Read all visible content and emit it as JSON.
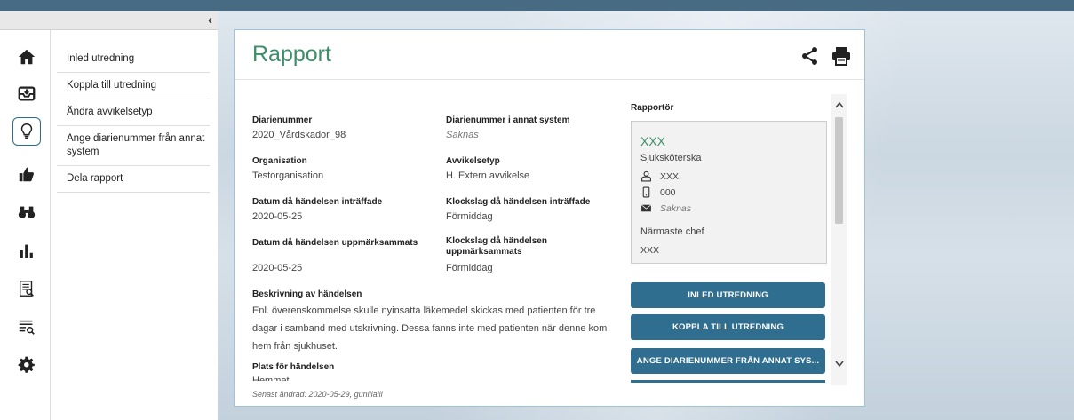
{
  "sidebar": {
    "collapse_glyph": "‹",
    "icons": [
      "home-icon",
      "inbox-icon",
      "lightbulb-icon",
      "thumbs-up-icon",
      "binoculars-icon",
      "bar-chart-icon",
      "document-search-icon",
      "list-search-icon",
      "settings-icon"
    ],
    "active_icon": "lightbulb-icon"
  },
  "menu": {
    "items": [
      {
        "label": "Inled utredning"
      },
      {
        "label": "Koppla till utredning"
      },
      {
        "label": "Ändra avvikelsetyp"
      },
      {
        "label": "Ange diarienummer från annat system"
      },
      {
        "label": "Dela rapport"
      }
    ]
  },
  "report": {
    "title": "Rapport",
    "fields": {
      "diarienummer_label": "Diarienummer",
      "diarienummer_value": "2020_Vårdskador_98",
      "diarienummer_annat_label": "Diarienummer i annat system",
      "diarienummer_annat_value": "Saknas",
      "organisation_label": "Organisation",
      "organisation_value": "Testorganisation",
      "avvikelsetyp_label": "Avvikelsetyp",
      "avvikelsetyp_value": "H. Extern avvikelse",
      "datum_inffade_label": "Datum då händelsen inträffade",
      "datum_inffade_value": "2020-05-25",
      "klockslag_inffade_label": "Klockslag då händelsen inträffade",
      "klockslag_inffade_value": "Förmiddag",
      "datum_uppm_label": "Datum då händelsen uppmärksammats",
      "datum_uppm_value": "2020-05-25",
      "klockslag_uppm_label": "Klockslag då händelsen uppmärksammats",
      "klockslag_uppm_value": "Förmiddag"
    },
    "beskrivning_label": "Beskrivning av händelsen",
    "beskrivning_text": "Enl. överenskommelse skulle nyinsatta läkemedel skickas med patienten för tre dagar i samband med utskrivning.  Dessa fanns inte med patienten när denne kom hem från sjukhuset.",
    "plats_label": "Plats för händelsen",
    "plats_value": "Hemmet",
    "footer": "Senast ändrad: 2020-05-29, gunillalil"
  },
  "rapportor": {
    "label": "Rapportör",
    "name": "XXX",
    "role": "Sjuksköterska",
    "user": "XXX",
    "phone": "000",
    "email": "Saknas",
    "chef_label": "Närmaste chef",
    "chef": "XXX"
  },
  "actions": {
    "inled": "INLED UTREDNING",
    "koppla": "KOPPLA TILL UTREDNING",
    "ange": "ANGE DIARIENUMMER FRÅN ANNAT SYS..."
  },
  "colors": {
    "accent_green": "#3e8e6a",
    "button_blue": "#2f6e8f",
    "topbar": "#466b82"
  }
}
